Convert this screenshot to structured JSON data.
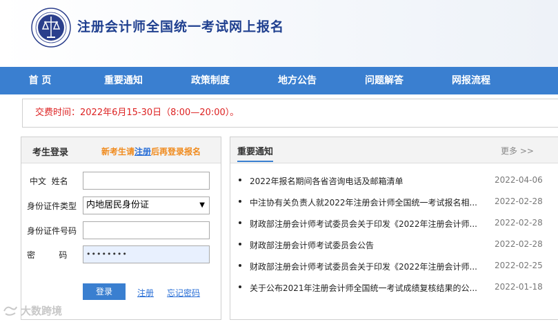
{
  "header": {
    "title": "注册会计师全国统一考试网上报名"
  },
  "nav": {
    "items": [
      {
        "label": "首 页"
      },
      {
        "label": "重要通知"
      },
      {
        "label": "政策制度"
      },
      {
        "label": "地方公告"
      },
      {
        "label": "问题解答"
      },
      {
        "label": "网报流程"
      }
    ]
  },
  "notice": {
    "text": "交费时间：2022年6月15-30日（8:00—20:00）。"
  },
  "login": {
    "title": "考生登录",
    "tip_prefix": "新考生请",
    "tip_link": "注册",
    "tip_suffix": "后再登录报名",
    "fields": [
      {
        "label": "中文  姓名",
        "value": "",
        "type": "text"
      },
      {
        "label": "身份证件类型",
        "value": "内地居民身份证",
        "type": "select"
      },
      {
        "label": "身份证件号码",
        "value": "",
        "type": "text"
      },
      {
        "label": "密         码",
        "value": "••••••••",
        "type": "password"
      }
    ],
    "login_button": "登录",
    "register_link": "注册",
    "forgot_link": "忘记密码"
  },
  "news": {
    "title": "重要通知",
    "more": "更多 >>",
    "items": [
      {
        "text": "2022年报名期间各省咨询电话及邮箱清单",
        "date": "2022-04-06"
      },
      {
        "text": "中注协有关负责人就2022年注册会计师全国统一考试报名相...",
        "date": "2022-02-28"
      },
      {
        "text": "财政部注册会计师考试委员会关于印发《2022年注册会计师...",
        "date": "2022-02-28"
      },
      {
        "text": "财政部注册会计师考试委员会公告",
        "date": "2022-02-28"
      },
      {
        "text": "财政部注册会计师考试委员会关于印发《2022年注册会计师...",
        "date": "2022-02-25"
      },
      {
        "text": "关于公布2021年注册会计师全国统一考试成绩复核结果的公...",
        "date": "2022-01-18"
      }
    ]
  },
  "watermark": {
    "text": "大数跨境"
  },
  "colors": {
    "nav_bg": "#3a7fd0",
    "title": "#1f3f8f",
    "notice_text": "#dd2222",
    "tip": "#f08a1c",
    "link": "#2a6fd6"
  }
}
